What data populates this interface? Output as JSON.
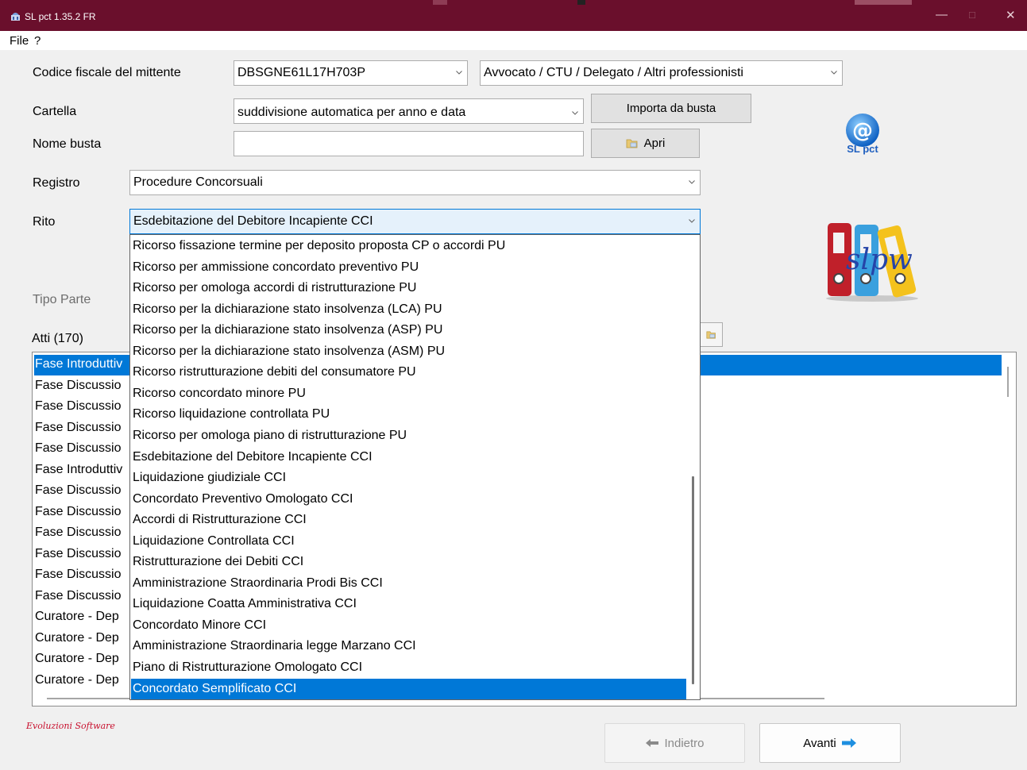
{
  "window": {
    "title": "SL pct 1.35.2 FR",
    "accent": "#6a0f2c"
  },
  "menu": {
    "file": "File",
    "help": "?"
  },
  "form": {
    "mittente_label": "Codice fiscale del mittente",
    "mittente_value": "DBSGNE61L17H703P",
    "ruolo_value": "Avvocato / CTU / Delegato / Altri professionisti",
    "cartella_label": "Cartella",
    "cartella_value": "suddivisione automatica per anno e data",
    "importa_button": "Importa da busta",
    "nome_busta_label": "Nome busta",
    "nome_busta_value": "",
    "apri_button": "Apri",
    "registro_label": "Registro",
    "registro_value": "Procedure Concorsuali",
    "rito_label": "Rito",
    "rito_value": "Esdebitazione del Debitore Incapiente CCI",
    "tipo_parte_label": "Tipo Parte",
    "atti_label": "Atti (170)"
  },
  "logos": {
    "slpct": "SL pct",
    "slpw": "slpw"
  },
  "atti": [
    "Fase Introduttiv",
    "Fase Discussio",
    "Fase Discussio",
    "Fase Discussio",
    "Fase Discussio",
    "Fase Introduttiv",
    "Fase Discussio",
    "Fase Discussio",
    "Fase Discussio",
    "Fase Discussio",
    "Fase Discussio",
    "Fase Discussio",
    "Curatore - Dep",
    "Curatore - Dep",
    "Curatore - Dep",
    "Curatore - Dep"
  ],
  "rito_options": [
    "Ricorso fissazione termine per deposito proposta CP o accordi PU",
    "Ricorso per ammissione concordato preventivo PU",
    "Ricorso per omologa accordi di ristrutturazione PU",
    "Ricorso per la dichiarazione stato insolvenza (LCA) PU",
    "Ricorso per la dichiarazione stato insolvenza (ASP) PU",
    "Ricorso per la dichiarazione stato insolvenza (ASM) PU",
    "Ricorso ristrutturazione debiti del consumatore PU",
    "Ricorso concordato minore PU",
    "Ricorso liquidazione controllata PU",
    "Ricorso per omologa piano di ristrutturazione PU",
    "Esdebitazione del Debitore Incapiente CCI",
    "Liquidazione giudiziale CCI",
    "Concordato Preventivo Omologato CCI",
    "Accordi di Ristrutturazione CCI",
    "Liquidazione Controllata CCI",
    "Ristrutturazione dei Debiti CCI",
    "Amministrazione Straordinaria Prodi Bis CCI",
    "Liquidazione Coatta Amministrativa CCI",
    "Concordato Minore CCI",
    "Amministrazione Straordinaria legge Marzano CCI",
    "Piano di Ristrutturazione Omologato CCI",
    "Concordato Semplificato CCI"
  ],
  "rito_selected_index": 21,
  "nav": {
    "back": "Indietro",
    "next": "Avanti"
  },
  "footer": {
    "brand": "Evoluzioni Software"
  },
  "colors": {
    "selection": "#0078d7",
    "next_arrow": "#1e8fe0",
    "brand": "#c8102e"
  }
}
